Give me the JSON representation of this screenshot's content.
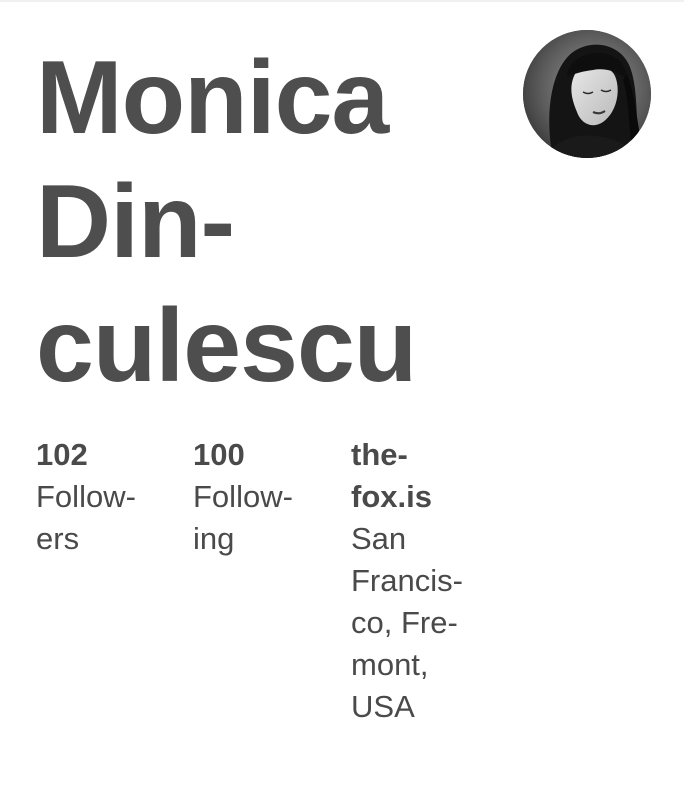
{
  "profile": {
    "name_lines": [
      "Monica",
      "Din-",
      "culescu"
    ],
    "avatar_icon": "portrait-photo"
  },
  "stats": {
    "followers": {
      "value": "102",
      "label_lines": [
        "Follow-",
        "ers"
      ]
    },
    "following": {
      "value": "100",
      "label_lines": [
        "Follow-",
        "ing"
      ]
    }
  },
  "website": {
    "link_lines": [
      "the-",
      "fox.is"
    ],
    "location_lines": [
      "San",
      "Francis-",
      "co, Fre-",
      "mont,",
      "USA"
    ]
  },
  "colors": {
    "text": "#4a4a4a",
    "background": "#ffffff"
  }
}
